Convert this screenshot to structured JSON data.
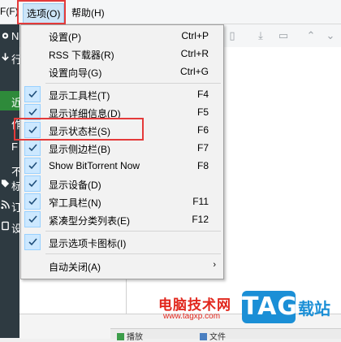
{
  "menubar": {
    "file_fragment": "F(F)",
    "options": "选项(O)",
    "help": "帮助(H)"
  },
  "sidebar": {
    "fragments": [
      "N",
      "行",
      "近",
      "作",
      "F",
      "不",
      "标",
      "订",
      "设"
    ]
  },
  "menu": {
    "items": [
      {
        "label": "设置(P)",
        "shortcut": "Ctrl+P",
        "checked": false
      },
      {
        "label": "RSS 下载器(R)",
        "shortcut": "Ctrl+R",
        "checked": false
      },
      {
        "label": "设置向导(G)",
        "shortcut": "Ctrl+G",
        "checked": false
      },
      {
        "label": "显示工具栏(T)",
        "shortcut": "F4",
        "checked": true
      },
      {
        "label": "显示详细信息(D)",
        "shortcut": "F5",
        "checked": true
      },
      {
        "label": "显示状态栏(S)",
        "shortcut": "F6",
        "checked": true
      },
      {
        "label": "显示侧边栏(B)",
        "shortcut": "F7",
        "checked": true
      },
      {
        "label": "Show BitTorrent Now",
        "shortcut": "F8",
        "checked": true
      },
      {
        "label": "显示设备(D)",
        "shortcut": "",
        "checked": true
      },
      {
        "label": "窄工具栏(N)",
        "shortcut": "F11",
        "checked": true
      },
      {
        "label": "紧凑型分类列表(E)",
        "shortcut": "F12",
        "checked": true
      },
      {
        "label": "显示选项卡图标(I)",
        "shortcut": "",
        "checked": true
      },
      {
        "label": "自动关闭(A)",
        "shortcut": "",
        "checked": false,
        "submenu": true
      }
    ]
  },
  "bottom_tabs": {
    "tab1": "播放",
    "tab2": "文件"
  },
  "watermark": {
    "site_name": "电脑技术网",
    "url": "www.tagxp.com",
    "logo": "TAG",
    "tail": "载站"
  },
  "colors": {
    "highlight_red": "#e43a3a",
    "check_bg": "#cce8ff",
    "sidebar_bg": "#2e3a41",
    "watermark_red": "#e1261c",
    "watermark_blue": "#1b8fd6"
  }
}
